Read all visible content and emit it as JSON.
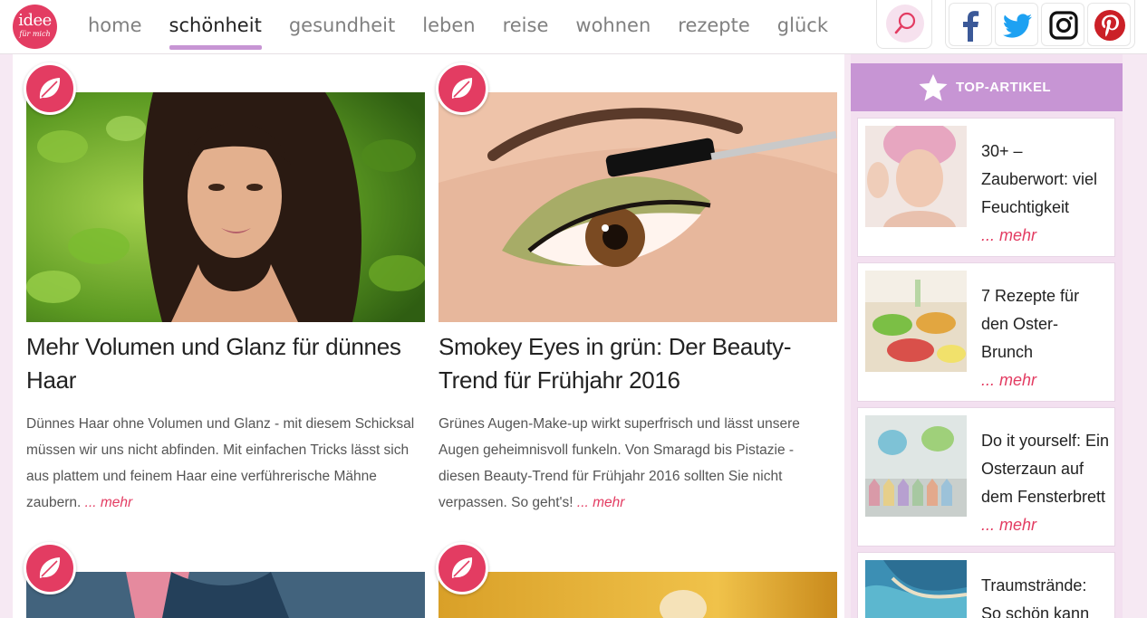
{
  "logo": {
    "line1": "idee",
    "line2": "für mich"
  },
  "nav": {
    "items": [
      {
        "label": "home"
      },
      {
        "label": "schönheit"
      },
      {
        "label": "gesundheit"
      },
      {
        "label": "leben"
      },
      {
        "label": "reise"
      },
      {
        "label": "wohnen"
      },
      {
        "label": "rezepte"
      },
      {
        "label": "glück"
      }
    ],
    "active": "schönheit",
    "search_icon": "search-icon"
  },
  "social": [
    "facebook-icon",
    "twitter-icon",
    "instagram-icon",
    "pinterest-icon"
  ],
  "articles": [
    {
      "title": "Mehr Volumen und Glanz für dünnes Haar",
      "text": "Dünnes Haar ohne Volumen und Glanz - mit diesem Schicksal müssen wir uns nicht abfinden. Mit einfachen Tricks lässt sich aus plattem und feinem Haar eine verführerische Mähne zaubern.",
      "more": "... mehr",
      "badge_icon": "leaf-icon"
    },
    {
      "title": "Smokey Eyes in grün: Der Beauty-Trend für Frühjahr 2016",
      "text": "Grünes Augen-Make-up wirkt superfrisch und lässt unsere Augen geheimnisvoll funkeln. Von Smaragd bis Pistazie - diesen Beauty-Trend für Frühjahr 2016 sollten Sie nicht verpassen. So geht's!",
      "more": "... mehr",
      "badge_icon": "leaf-icon"
    }
  ],
  "sidebar": {
    "heading": "TOP-ARTIKEL",
    "heading_icon": "star-icon",
    "items": [
      {
        "title": "30+ – Zauberwort: viel Feuchtigkeit",
        "more": "... mehr"
      },
      {
        "title": "7 Rezepte für den Oster-Brunch",
        "more": "... mehr"
      },
      {
        "title": "Do it yourself: Ein Osterzaun auf dem Fensterbrett",
        "more": "... mehr"
      },
      {
        "title": "Traumstrände: So schön kann"
      }
    ]
  },
  "colors": {
    "accent": "#e33c62",
    "lilac": "#c795d4",
    "nav_text": "#808080"
  }
}
